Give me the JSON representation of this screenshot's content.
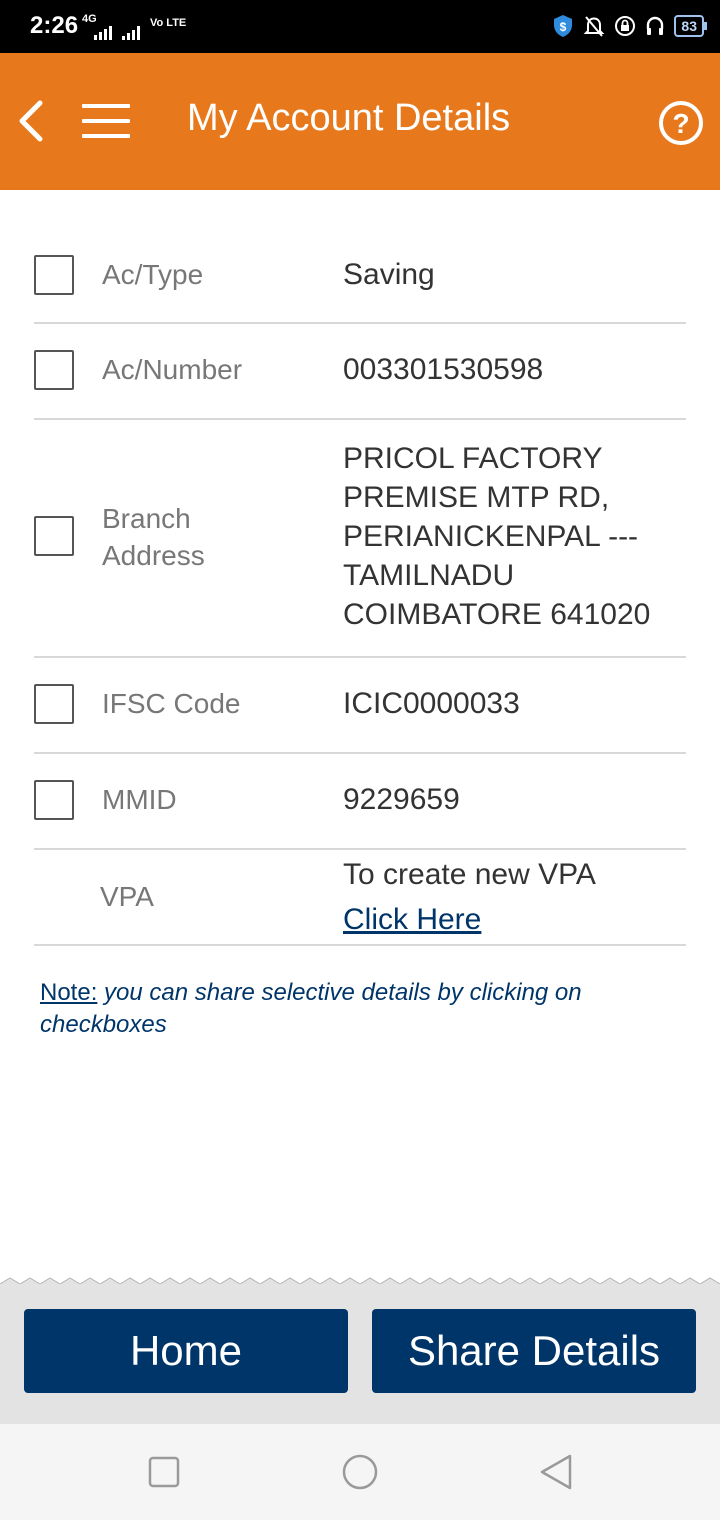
{
  "status_bar": {
    "time": "2:26",
    "network": "4G",
    "volte": "Vo LTE",
    "battery": "83",
    "icons": [
      "vpn-shield-icon",
      "notifications-off-icon",
      "lock-rotation-icon",
      "headphones-icon",
      "battery-icon"
    ]
  },
  "header": {
    "title": "My Account Details",
    "back_icon": "chevron-left-icon",
    "menu_icon": "hamburger-menu-icon",
    "help_icon": "help-circle-icon"
  },
  "details": [
    {
      "label": "Ac/Type",
      "value": "Saving"
    },
    {
      "label": "Ac/Number",
      "value": "003301530598"
    },
    {
      "label": "Branch\nAddress",
      "value_lines": [
        "PRICOL FACTORY",
        "PREMISE MTP RD,",
        "PERIANICKENPAL ---",
        "TAMILNADU",
        "COIMBATORE 641020"
      ]
    },
    {
      "label": "IFSC Code",
      "value": "ICIC0000033"
    },
    {
      "label": "MMID",
      "value": "9229659"
    },
    {
      "label": "VPA",
      "value": "To create new VPA",
      "link": "Click Here"
    }
  ],
  "note": {
    "heading": "Note:",
    "text": " you can share selective details by clicking on checkboxes"
  },
  "buttons": {
    "home": "Home",
    "share": "Share Details"
  },
  "colors": {
    "header_bg": "#e8781c",
    "button_bg": "#00356a",
    "link": "#00356a"
  }
}
